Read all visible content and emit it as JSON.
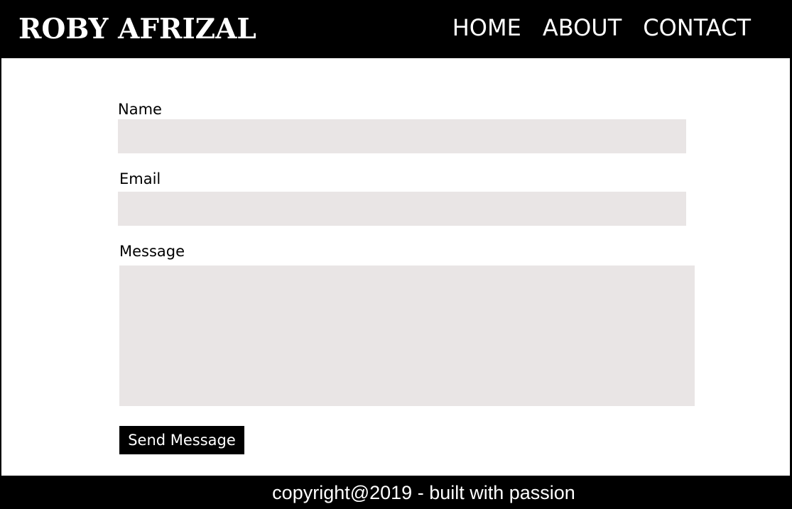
{
  "header": {
    "brand": "ROBY AFRIZAL",
    "nav": [
      {
        "label": "HOME"
      },
      {
        "label": "ABOUT"
      },
      {
        "label": "CONTACT"
      }
    ]
  },
  "form": {
    "name": {
      "label": "Name",
      "value": "",
      "placeholder": ""
    },
    "email": {
      "label": "Email",
      "value": "",
      "placeholder": ""
    },
    "message": {
      "label": "Message",
      "value": "",
      "placeholder": ""
    },
    "submit_label": "Send Message"
  },
  "footer": {
    "text": "copyright@2019 - built with passion"
  },
  "colors": {
    "background": "#000000",
    "content": "#ffffff",
    "field": "#e9e5e5",
    "text": "#000000",
    "button": "#000000",
    "button_text": "#ffffff"
  }
}
